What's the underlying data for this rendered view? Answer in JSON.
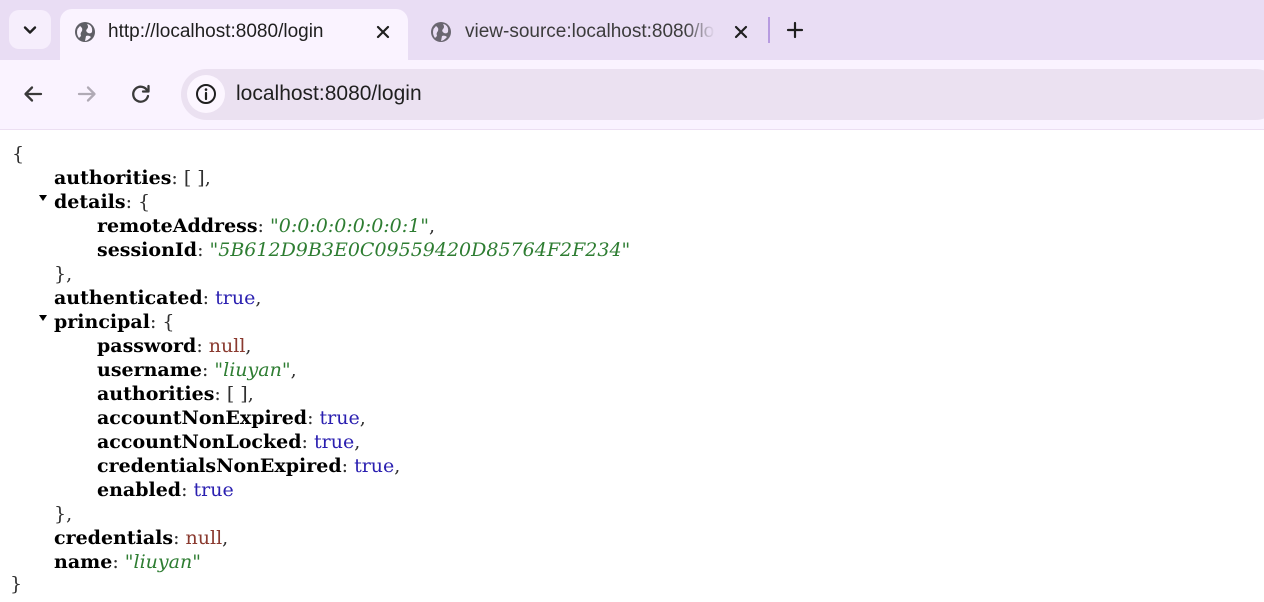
{
  "browser": {
    "tabs": [
      {
        "title": "http://localhost:8080/login",
        "active": true
      },
      {
        "title": "view-source:localhost:8080/login",
        "active": false
      }
    ],
    "address": "localhost:8080/login",
    "icons": {
      "tab_search": "chevron-down-icon",
      "tab_favicon": "globe-icon",
      "close": "close-icon",
      "new_tab": "plus-icon",
      "back": "arrow-left-icon",
      "forward": "arrow-right-icon",
      "reload": "reload-icon",
      "site_info": "info-icon"
    },
    "colors": {
      "tabstrip": "#e9ddf4",
      "toolbar": "#faf3ff",
      "omnibox": "#ebe1f1"
    }
  },
  "json": {
    "open_brace": "{",
    "close_brace": "}",
    "authorities": {
      "key": "authorities",
      "value": "[ ]"
    },
    "details": {
      "key": "details",
      "open": "{",
      "close": "},",
      "remoteAddress": {
        "key": "remoteAddress",
        "value": "\"0:0:0:0:0:0:0:1\""
      },
      "sessionId": {
        "key": "sessionId",
        "value": "\"5B612D9B3E0C09559420D85764F2F234\""
      }
    },
    "authenticated": {
      "key": "authenticated",
      "value": "true"
    },
    "principal": {
      "key": "principal",
      "open": "{",
      "close": "},",
      "password": {
        "key": "password",
        "value": "null"
      },
      "username": {
        "key": "username",
        "value": "\"liuyan\""
      },
      "authorities": {
        "key": "authorities",
        "value": "[ ]"
      },
      "accountNonExpired": {
        "key": "accountNonExpired",
        "value": "true"
      },
      "accountNonLocked": {
        "key": "accountNonLocked",
        "value": "true"
      },
      "credentialsNonExpired": {
        "key": "credentialsNonExpired",
        "value": "true"
      },
      "enabled": {
        "key": "enabled",
        "value": "true"
      }
    },
    "credentials": {
      "key": "credentials",
      "value": "null"
    },
    "name": {
      "key": "name",
      "value": "\"liuyan\""
    },
    "colors": {
      "string": "#2e7d32",
      "boolean": "#2a1fb0",
      "null": "#8a3a2f"
    }
  }
}
